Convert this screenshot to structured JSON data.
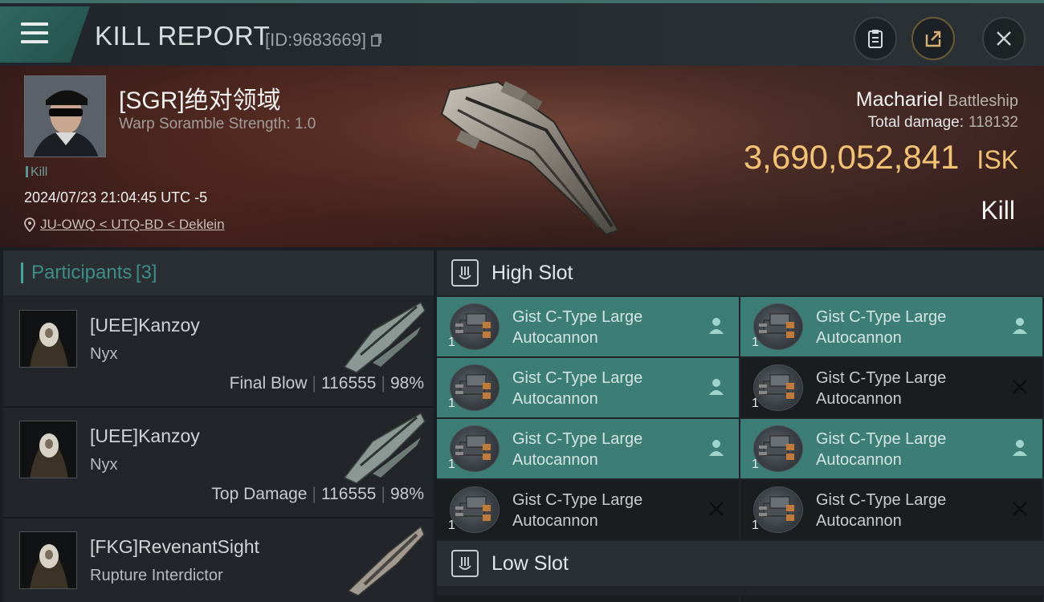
{
  "header": {
    "title": "KILL REPORT",
    "id_text": "[ID:9683669]"
  },
  "victim": {
    "pilot": "[SGR]绝对领域",
    "scramble": "Warp Soramble Strength: 1.0",
    "kill_tag": "Kill",
    "timestamp": "2024/07/23 21:04:45 UTC -5",
    "location": "JU-OWQ < UTQ-BD < Deklein",
    "ship": "Machariel",
    "ship_class": "Battleship",
    "total_damage_label": "Total damage:",
    "total_damage": "118132",
    "isk_value": "3,690,052,841",
    "isk_unit": "ISK",
    "result": "Kill"
  },
  "participants": {
    "label": "Participants",
    "count": "[3]",
    "rows": [
      {
        "name": "[UEE]Kanzoy",
        "ship": "Nyx",
        "role": "Final Blow",
        "damage": "116555",
        "percent": "98%"
      },
      {
        "name": "[UEE]Kanzoy",
        "ship": "Nyx",
        "role": "Top Damage",
        "damage": "116555",
        "percent": "98%"
      },
      {
        "name": "[FKG]RevenantSight",
        "ship": "Rupture Interdictor",
        "badge": "i"
      }
    ]
  },
  "high_slot": {
    "label": "High Slot",
    "items": [
      {
        "line1": "Gist C-Type Large",
        "line2": "Autocannon",
        "qty": "1",
        "status": "dropped"
      },
      {
        "line1": "Gist C-Type Large",
        "line2": "Autocannon",
        "qty": "1",
        "status": "dropped"
      },
      {
        "line1": "Gist C-Type Large",
        "line2": "Autocannon",
        "qty": "1",
        "status": "dropped"
      },
      {
        "line1": "Gist C-Type Large",
        "line2": "Autocannon",
        "qty": "1",
        "status": "destroyed"
      },
      {
        "line1": "Gist C-Type Large",
        "line2": "Autocannon",
        "qty": "1",
        "status": "dropped"
      },
      {
        "line1": "Gist C-Type Large",
        "line2": "Autocannon",
        "qty": "1",
        "status": "dropped"
      },
      {
        "line1": "Gist C-Type Large",
        "line2": "Autocannon",
        "qty": "1",
        "status": "destroyed"
      },
      {
        "line1": "Gist C-Type Large",
        "line2": "Autocannon",
        "qty": "1",
        "status": "destroyed"
      }
    ]
  },
  "low_slot": {
    "label": "Low Slot"
  },
  "colors": {
    "accent": "#3c7e76",
    "isk": "#f2c373",
    "participants_title": "#3d8e86"
  }
}
